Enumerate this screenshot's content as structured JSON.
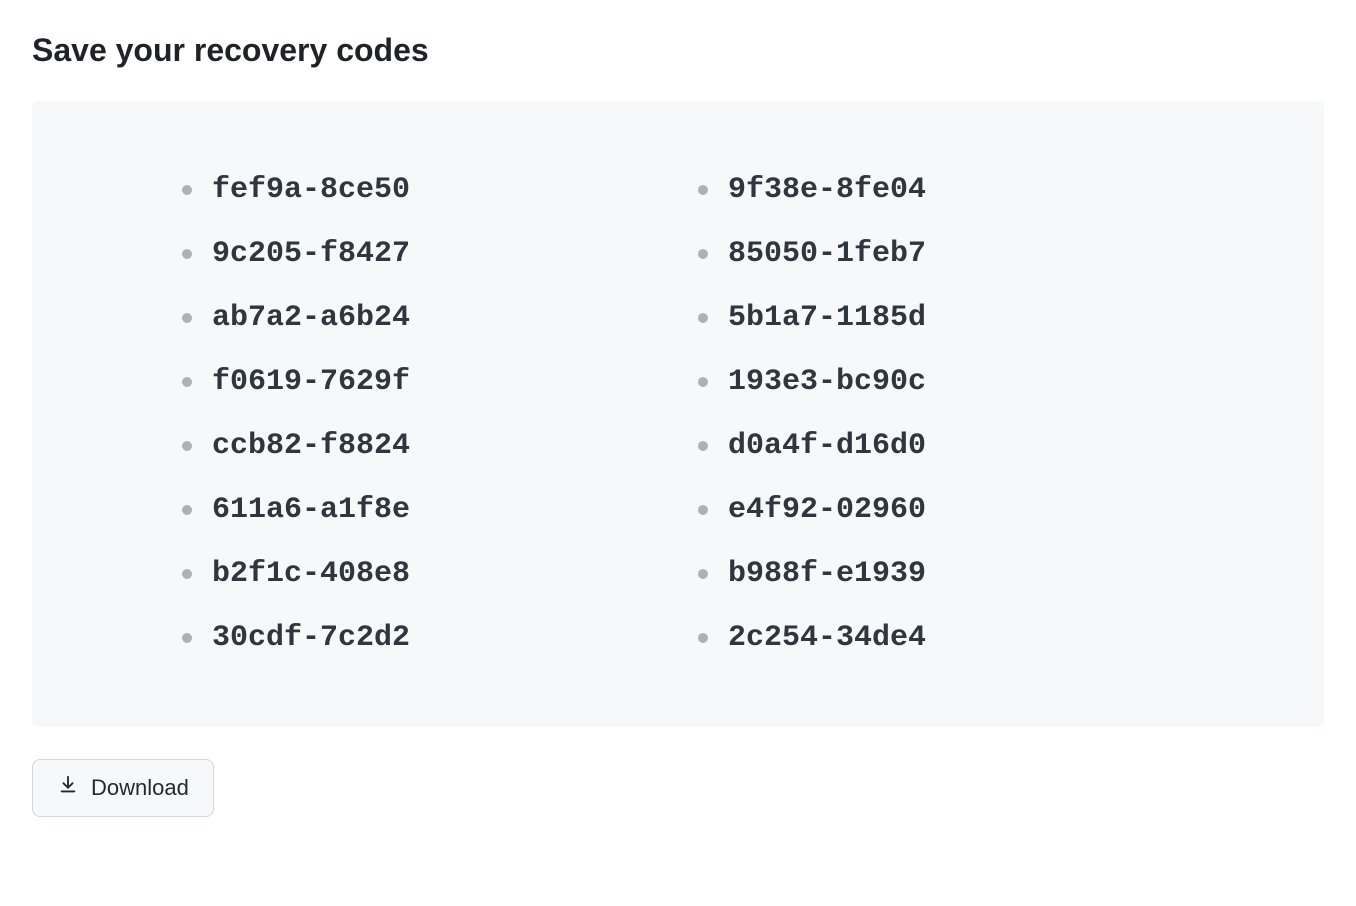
{
  "title": "Save your recovery codes",
  "recovery_codes": {
    "left": [
      "fef9a-8ce50",
      "9c205-f8427",
      "ab7a2-a6b24",
      "f0619-7629f",
      "ccb82-f8824",
      "611a6-a1f8e",
      "b2f1c-408e8",
      "30cdf-7c2d2"
    ],
    "right": [
      "9f38e-8fe04",
      "85050-1feb7",
      "5b1a7-1185d",
      "193e3-bc90c",
      "d0a4f-d16d0",
      "e4f92-02960",
      "b988f-e1939",
      "2c254-34de4"
    ]
  },
  "download_label": "Download"
}
